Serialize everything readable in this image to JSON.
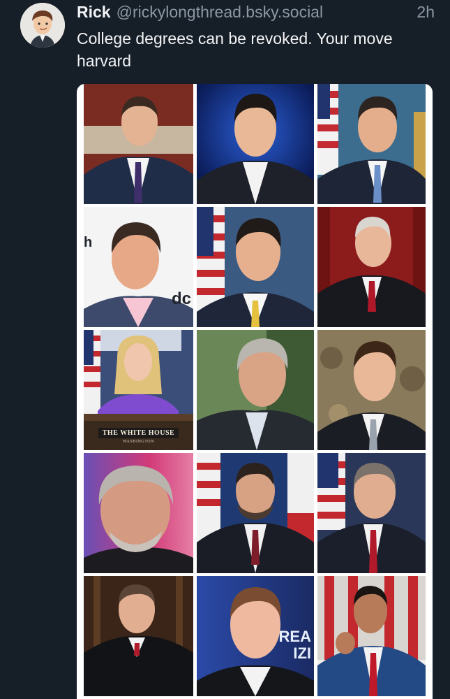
{
  "post": {
    "author_name": "Rick",
    "author_handle": "@rickylongthread.bsky.social",
    "timestamp": "2h",
    "text": "College degrees can be revoked. Your move harvard"
  },
  "image_text": {
    "podium_title": "THE WHITE HOUSE",
    "podium_subtitle": "WASHINGTON",
    "bg_fragment_1": "dc",
    "bg_fragment_2": "h",
    "banner_fragment_1": "REA",
    "banner_fragment_2": "IZI"
  },
  "colors": {
    "background": "#161e27",
    "text_primary": "#f1f3f5",
    "text_secondary": "#8b98a5"
  }
}
